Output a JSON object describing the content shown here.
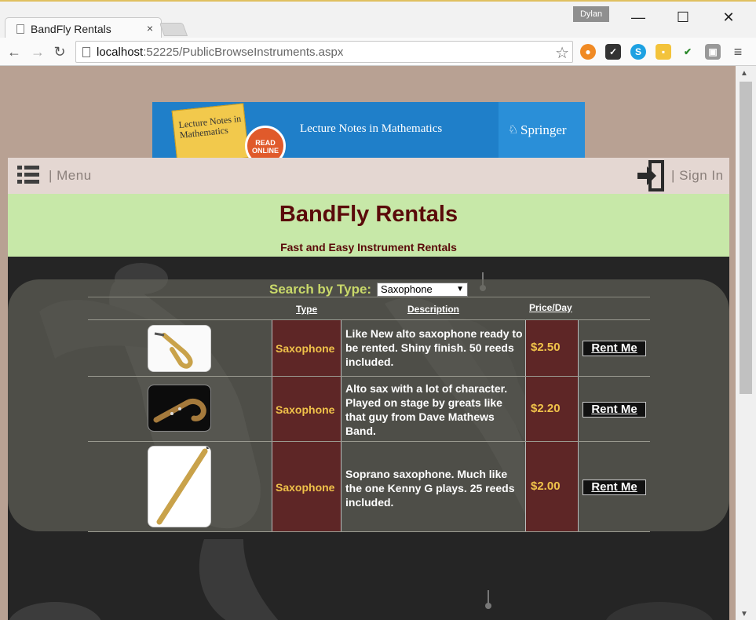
{
  "browser": {
    "tab_title": "BandFly Rentals",
    "tab_close": "×",
    "user_name": "Dylan",
    "url_host": "localhost",
    "url_rest": ":52225/PublicBrowseInstruments.aspx",
    "window_minimize": "—",
    "window_maximize": "☐",
    "window_close": "✕"
  },
  "ad": {
    "book_title": "Lecture Notes in Mathematics",
    "read_online": "READ ONLINE",
    "headline": "Lecture Notes in Mathematics",
    "brand": "Springer"
  },
  "nav": {
    "menu_label": "| Menu",
    "signin_label": "| Sign In"
  },
  "header": {
    "title": "BandFly Rentals",
    "subtitle": "Fast and Easy Instrument Rentals"
  },
  "search": {
    "label": "Search by Type:",
    "selected": "Saxophone"
  },
  "table": {
    "columns": {
      "type": "Type",
      "description": "Description",
      "price": "Price/Day"
    },
    "rows": [
      {
        "type": "Saxophone",
        "description": "Like New alto saxophone ready to be rented. Shiny finish. 50 reeds included.",
        "price": "$2.50",
        "action": "Rent Me"
      },
      {
        "type": "Saxophone",
        "description": "Alto sax with a lot of character. Played on stage by greats like that guy from Dave Mathews Band.",
        "price": "$2.20",
        "action": "Rent Me"
      },
      {
        "type": "Saxophone",
        "description": "Soprano saxophone. Much like the one Kenny G plays. 25 reeds included.",
        "price": "$2.00",
        "action": "Rent Me"
      }
    ]
  },
  "colors": {
    "header_bg": "#c7e8a8",
    "title_color": "#5a0a0a",
    "accent_gold": "#f0c24a",
    "cell_maroon": "#5e2626"
  }
}
